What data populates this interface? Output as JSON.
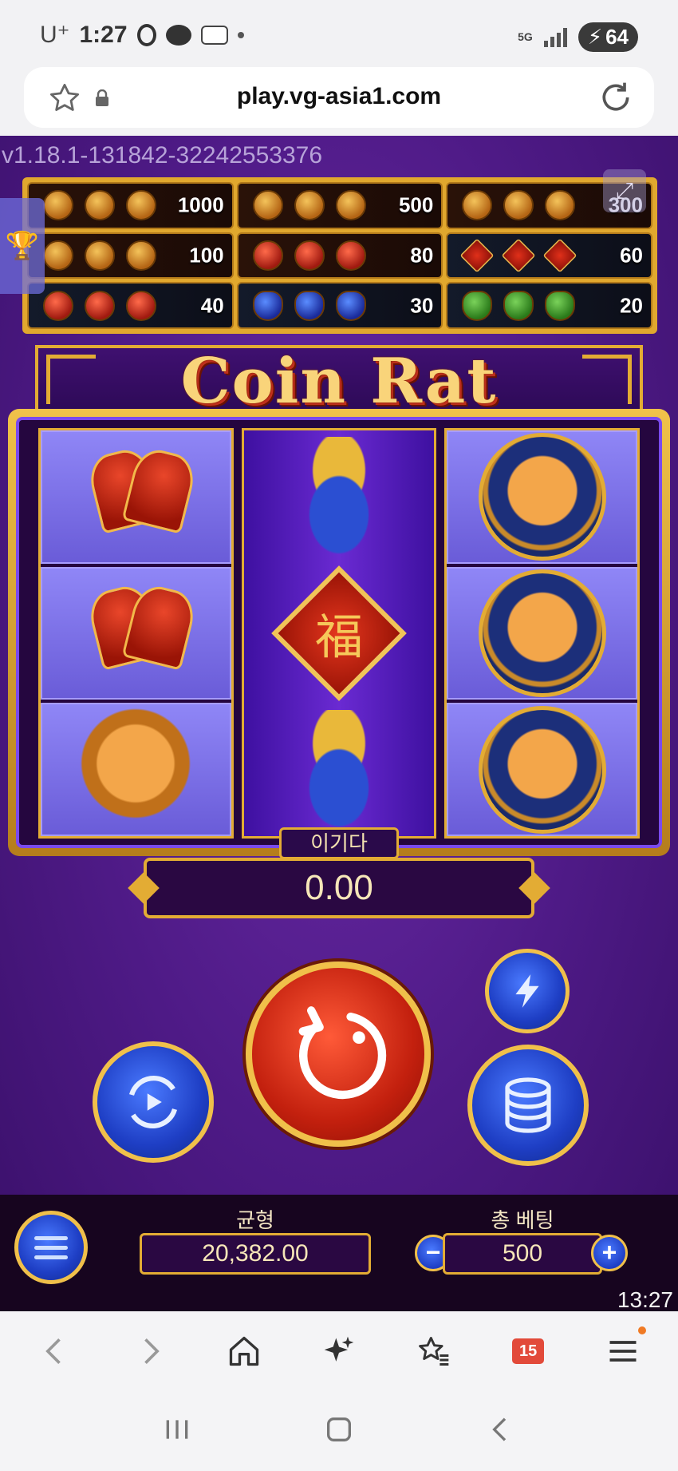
{
  "status_bar": {
    "carrier": "U⁺",
    "time": "1:27",
    "network": "5G",
    "battery": "64"
  },
  "browser": {
    "url": "play.vg-asia1.com"
  },
  "game": {
    "version": "v1.18.1-131842-32242553376",
    "title": "Coin Rat",
    "paytable": [
      {
        "symbol": "wild-rat",
        "value": "1000"
      },
      {
        "symbol": "rat-coin",
        "value": "500"
      },
      {
        "symbol": "rat-coin-small",
        "value": "300"
      },
      {
        "symbol": "gold-coin",
        "value": "100"
      },
      {
        "symbol": "bells",
        "value": "80"
      },
      {
        "symbol": "fu-diamond",
        "value": "60"
      },
      {
        "symbol": "red-bag",
        "value": "40"
      },
      {
        "symbol": "blue-bag",
        "value": "30"
      },
      {
        "symbol": "green-bag",
        "value": "20"
      }
    ],
    "reels": [
      [
        "bells",
        "bells",
        "rat-coin"
      ],
      [
        "blue-bag",
        "fu-diamond",
        "blue-bag"
      ],
      [
        "rat-coin",
        "rat-coin",
        "rat-coin"
      ]
    ],
    "fu_char": "福",
    "win_label": "이기다",
    "win_value": "0.00",
    "balance_label": "균형",
    "balance_value": "20,382.00",
    "bet_label": "총 베팅",
    "bet_value": "500",
    "minus": "−",
    "plus": "+",
    "clock": "13:27"
  },
  "browser_nav": {
    "tab_count": "15"
  }
}
